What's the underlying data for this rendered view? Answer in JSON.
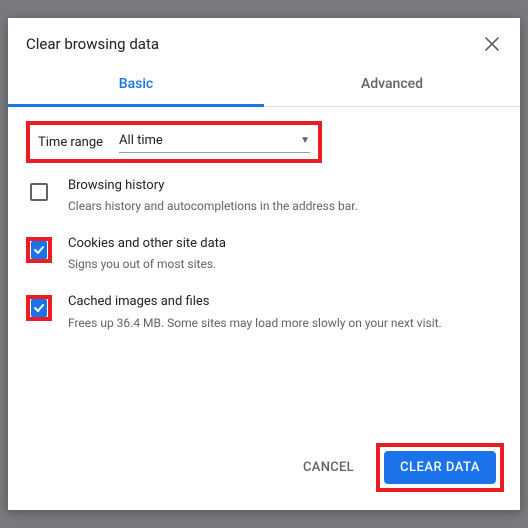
{
  "dialog": {
    "title": "Clear browsing data",
    "close_icon": "close"
  },
  "tabs": {
    "basic": "Basic",
    "advanced": "Advanced"
  },
  "time_range": {
    "label": "Time range",
    "value": "All time"
  },
  "options": [
    {
      "title": "Browsing history",
      "desc": "Clears history and autocompletions in the address bar.",
      "checked": false
    },
    {
      "title": "Cookies and other site data",
      "desc": "Signs you out of most sites.",
      "checked": true
    },
    {
      "title": "Cached images and files",
      "desc": "Frees up 36.4 MB. Some sites may load more slowly on your next visit.",
      "checked": true
    }
  ],
  "footer": {
    "cancel": "CANCEL",
    "clear": "CLEAR DATA"
  }
}
